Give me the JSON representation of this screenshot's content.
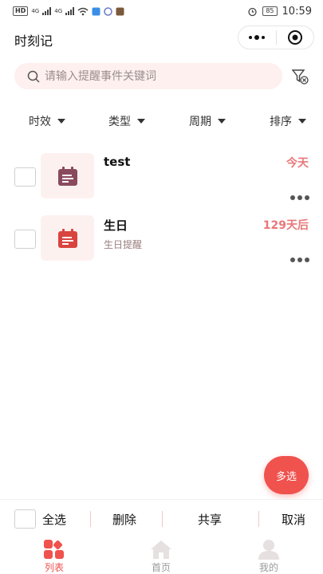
{
  "status_bar": {
    "left_chips": [
      "HD",
      "4G",
      "4G"
    ],
    "battery": "85",
    "time": "10:59"
  },
  "header": {
    "title": "时刻记"
  },
  "search": {
    "placeholder": "请输入提醒事件关键词"
  },
  "filters": [
    {
      "label": "时效"
    },
    {
      "label": "类型"
    },
    {
      "label": "周期"
    },
    {
      "label": "排序"
    }
  ],
  "items": [
    {
      "title": "test",
      "subtitle": "",
      "badge": "今天",
      "icon": "calendar-icon",
      "icon_color": "#8a4a5e"
    },
    {
      "title": "生日",
      "subtitle": "生日提醒",
      "badge": "129天后",
      "icon": "calendar-icon",
      "icon_color": "#d9443f"
    }
  ],
  "fab": {
    "label": "多选"
  },
  "action_bar": {
    "select_all": "全选",
    "delete": "删除",
    "share": "共享",
    "cancel": "取消"
  },
  "tabs": [
    {
      "label": "列表",
      "icon": "grid-icon",
      "active": true
    },
    {
      "label": "首页",
      "icon": "home-icon",
      "active": false
    },
    {
      "label": "我的",
      "icon": "user-icon",
      "active": false
    }
  ],
  "colors": {
    "accent": "#f0524e",
    "badge": "#e8787a",
    "search_bg": "#fdf0ee"
  }
}
